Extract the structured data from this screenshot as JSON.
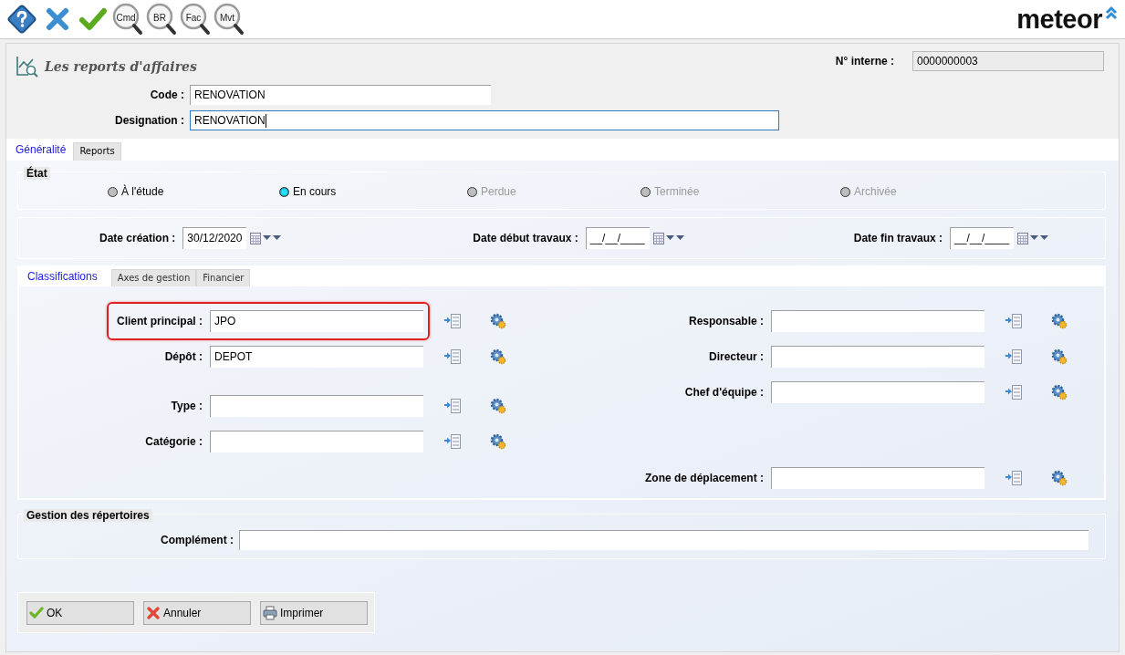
{
  "toolbar": {
    "items": [
      {
        "kind": "help"
      },
      {
        "kind": "cancel"
      },
      {
        "kind": "validate"
      },
      {
        "kind": "lookup",
        "label": "Cmd"
      },
      {
        "kind": "lookup",
        "label": "BR"
      },
      {
        "kind": "lookup",
        "label": "Fac"
      },
      {
        "kind": "lookup",
        "label": "Mvt"
      }
    ],
    "logo": "meteor"
  },
  "header": {
    "title": "Les reports d'affaires",
    "internal_number": {
      "label": "N° interne :",
      "value": "0000000003"
    },
    "fields": [
      {
        "label": "Code :",
        "value": "RENOVATION",
        "focused": false
      },
      {
        "label": "Designation :",
        "value": "RENOVATION",
        "focused": true
      }
    ]
  },
  "tabs": [
    {
      "label": "Généralité",
      "selected": true
    },
    {
      "label": "Reports",
      "selected": false
    }
  ],
  "state_group": {
    "title": "État",
    "options": [
      {
        "label": "À l'étude",
        "selected": false,
        "disabled": false
      },
      {
        "label": "En cours",
        "selected": true,
        "disabled": false
      },
      {
        "label": "Perdue",
        "selected": false,
        "disabled": true
      },
      {
        "label": "Terminée",
        "selected": false,
        "disabled": true
      },
      {
        "label": "Archivée",
        "selected": false,
        "disabled": true
      }
    ]
  },
  "dates": [
    {
      "label": "Date création :",
      "value": "30/12/2020"
    },
    {
      "label": "Date début travaux :",
      "value": "__/__/____"
    },
    {
      "label": "Date fin travaux :",
      "value": "__/__/____"
    }
  ],
  "subtabs": [
    {
      "label": "Classifications",
      "selected": true
    },
    {
      "label": "Axes de gestion",
      "selected": false
    },
    {
      "label": "Financier",
      "selected": false
    }
  ],
  "classifications": {
    "left": [
      {
        "label": "Client principal :",
        "value": "JPO",
        "highlighted": true
      },
      {
        "label": "Dépôt :",
        "value": "DEPOT",
        "highlighted": false
      },
      {
        "label": "Type :",
        "highlighted": false
      },
      {
        "label": "Catégorie :",
        "highlighted": false
      }
    ],
    "right": [
      {
        "label": "Responsable :",
        "highlighted": false
      },
      {
        "label": "Directeur :",
        "highlighted": false
      },
      {
        "label": "Chef d'équipe :",
        "highlighted": false
      },
      {
        "label": "Zone de déplacement :",
        "highlighted": false
      }
    ]
  },
  "directories": {
    "title": "Gestion des répertoires",
    "fields": [
      {
        "label": "Complément :"
      }
    ]
  },
  "buttons": [
    {
      "kind": "ok",
      "label": "OK"
    },
    {
      "kind": "cancel",
      "label": "Annuler"
    },
    {
      "kind": "print",
      "label": "Imprimer"
    }
  ]
}
